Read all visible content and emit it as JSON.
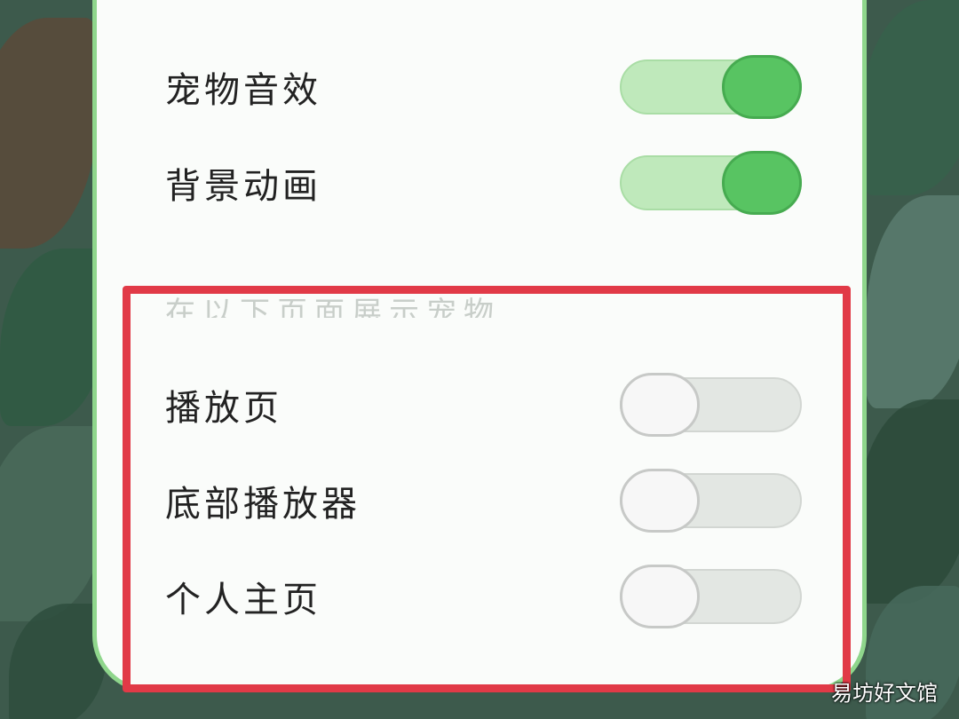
{
  "settings": {
    "toggles": [
      {
        "label": "宠物音效",
        "state": "on"
      },
      {
        "label": "背景动画",
        "state": "on"
      }
    ],
    "section_title": "在以下页面展示宠物",
    "page_toggles": [
      {
        "label": "播放页",
        "state": "off"
      },
      {
        "label": "底部播放器",
        "state": "off"
      },
      {
        "label": "个人主页",
        "state": "off"
      }
    ]
  },
  "watermark": "易坊好文馆",
  "colors": {
    "accent_green": "#58c462",
    "panel_border": "#8fd68c",
    "highlight_red": "#e13a47"
  }
}
